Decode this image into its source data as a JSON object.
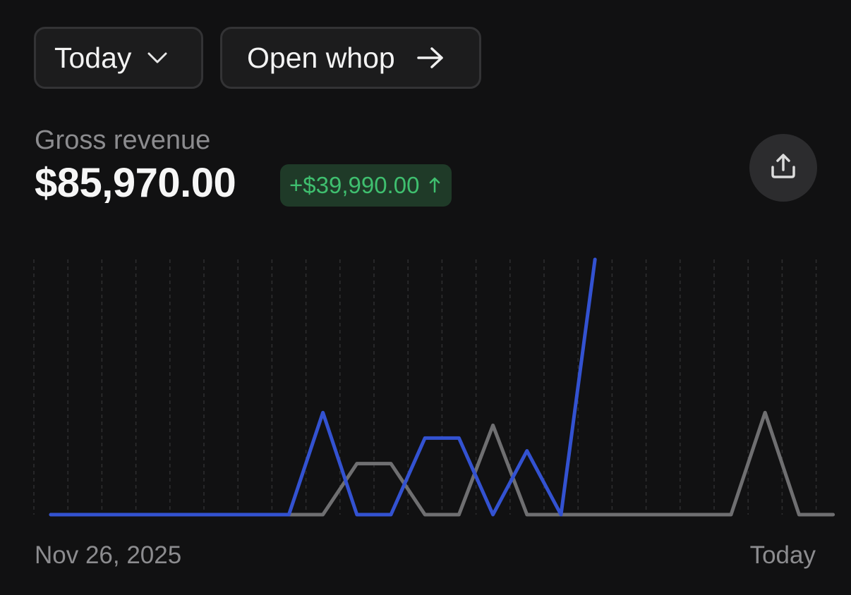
{
  "toolbar": {
    "date_range_label": "Today",
    "open_label": "Open whop"
  },
  "metric": {
    "label": "Gross revenue",
    "value": "$85,970.00",
    "change": "+$39,990.00"
  },
  "colors": {
    "background": "#111112",
    "current_series": "#3352d1",
    "previous_series": "#6f6f71",
    "positive": "#3fbf6f",
    "positive_bg": "#1f3a28"
  },
  "icons": {
    "date_range": "chevron-down-icon",
    "open": "arrow-right-icon",
    "change": "arrow-up-icon",
    "share": "share-icon"
  },
  "chart_data": {
    "type": "line",
    "grid": true,
    "x_labels": [
      "Nov 26, 2025",
      "Today"
    ],
    "x": [
      0,
      1,
      2,
      3,
      4,
      5,
      6,
      7,
      8,
      9,
      10,
      11,
      12,
      13,
      14,
      15,
      16,
      17,
      18,
      19,
      20,
      21,
      22,
      23
    ],
    "ylim": [
      0,
      100
    ],
    "series": [
      {
        "values": [
          0,
          0,
          0,
          0,
          0,
          0,
          0,
          0,
          40,
          0,
          0,
          30,
          30,
          0,
          25,
          0,
          100
        ]
      },
      {
        "values": [
          0,
          0,
          0,
          0,
          0,
          0,
          0,
          0,
          0,
          20,
          20,
          0,
          0,
          35,
          0,
          0,
          0,
          0,
          0,
          0,
          0,
          40,
          0,
          0
        ]
      }
    ]
  }
}
